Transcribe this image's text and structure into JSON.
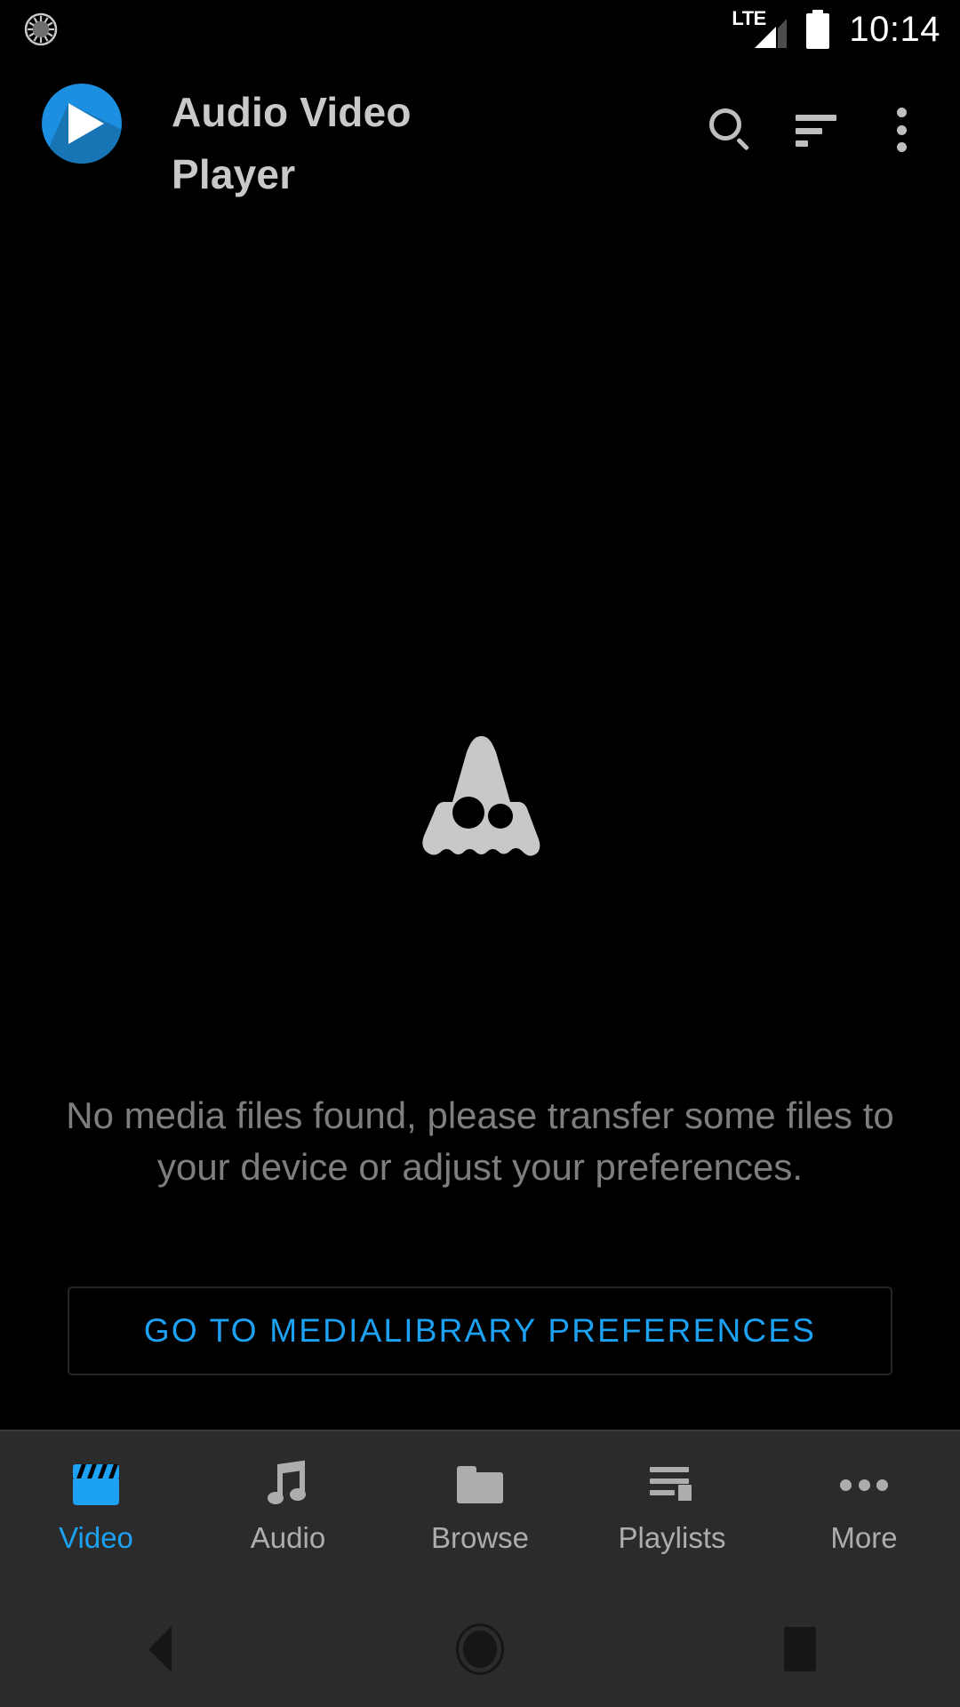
{
  "status_bar": {
    "left_icon": "sync-circle-icon",
    "network_type": "LTE",
    "signal_icon": "signal-bars-icon",
    "battery_icon": "battery-full-icon",
    "time": "10:14"
  },
  "app_bar": {
    "logo_icon": "play-circle-logo",
    "title": "Audio Video Player",
    "actions": [
      {
        "name": "search",
        "icon": "search-icon"
      },
      {
        "name": "sort",
        "icon": "sort-icon"
      },
      {
        "name": "overflow",
        "icon": "more-vertical-icon"
      }
    ]
  },
  "empty_state": {
    "icon": "ghost-icon",
    "message": "No media files found, please transfer some files to your device or adjust your preferences.",
    "button_label": "GO TO MEDIALIBRARY PREFERENCES"
  },
  "bottom_nav": {
    "active_index": 0,
    "items": [
      {
        "label": "Video",
        "icon": "clapperboard-icon"
      },
      {
        "label": "Audio",
        "icon": "music-note-icon"
      },
      {
        "label": "Browse",
        "icon": "folder-icon"
      },
      {
        "label": "Playlists",
        "icon": "playlist-play-icon"
      },
      {
        "label": "More",
        "icon": "more-horizontal-icon"
      }
    ]
  },
  "system_nav": {
    "back_label": "Back",
    "home_label": "Home",
    "recents_label": "Recents"
  },
  "colors": {
    "accent": "#1DA1F2",
    "background": "#000000",
    "nav_background": "#2B2B2B",
    "muted_text": "#7E7E7E",
    "title_text": "#C9C9C9"
  }
}
